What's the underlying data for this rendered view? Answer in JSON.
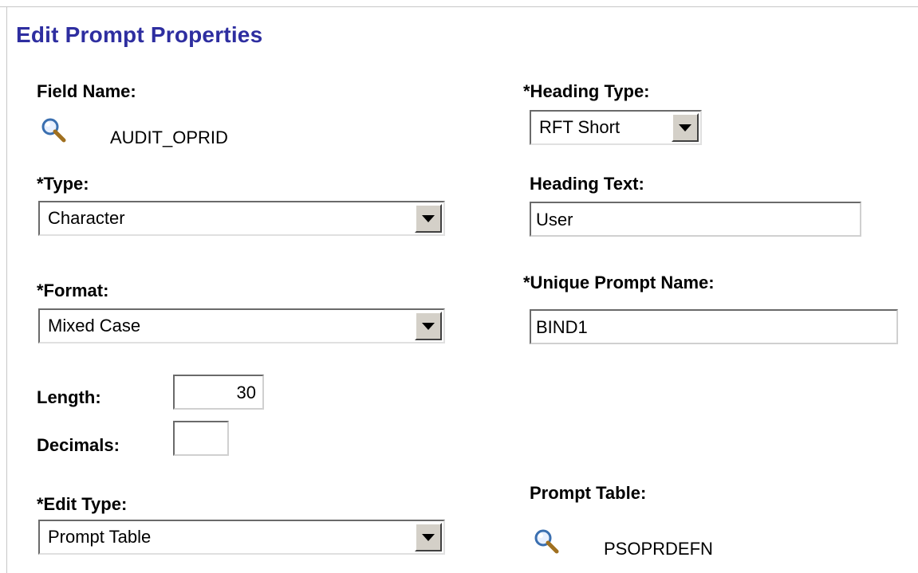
{
  "page": {
    "title": "Edit Prompt Properties"
  },
  "left": {
    "field_name": {
      "label": "Field Name:",
      "value": "AUDIT_OPRID",
      "icon": "magnifier-icon"
    },
    "type": {
      "label": "*Type:",
      "value": "Character"
    },
    "format": {
      "label": "*Format:",
      "value": "Mixed Case"
    },
    "length": {
      "label": "Length:",
      "value": "30"
    },
    "decimals": {
      "label": "Decimals:",
      "value": ""
    },
    "edit_type": {
      "label": "*Edit Type:",
      "value": "Prompt Table"
    }
  },
  "right": {
    "heading_type": {
      "label": "*Heading Type:",
      "value": "RFT Short"
    },
    "heading_text": {
      "label": "Heading Text:",
      "value": "User"
    },
    "unique_prompt_name": {
      "label": "*Unique Prompt Name:",
      "value": "BIND1"
    },
    "prompt_table": {
      "label": "Prompt Table:",
      "value": "PSOPRDEFN",
      "icon": "magnifier-icon"
    }
  },
  "colors": {
    "title": "#2e2ea0",
    "dropdown_button": "#d4d0c8",
    "frame_line": "#c7c7c7"
  }
}
